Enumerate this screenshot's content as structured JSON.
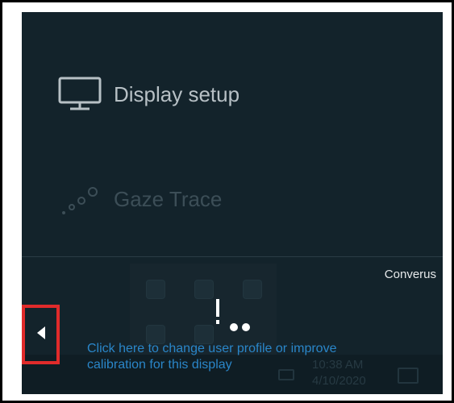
{
  "menu": {
    "display_setup": "Display setup",
    "gaze_trace": "Gaze Trace"
  },
  "brand": "Converus",
  "profile_link": "Click here to change user profile or improve calibration for this display",
  "taskbar": {
    "time": "10:38 AM",
    "date": "4/10/2020"
  },
  "colors": {
    "panel_bg": "#13232b",
    "link": "#2a86c9",
    "highlight_box": "#e02b2b"
  },
  "icons": {
    "display": "monitor-icon",
    "gaze": "gaze-dots-icon",
    "back": "back-arrow-icon"
  }
}
